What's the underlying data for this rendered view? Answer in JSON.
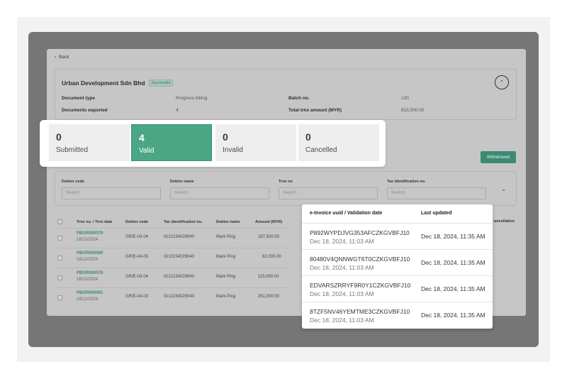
{
  "nav": {
    "back_label": "Back",
    "back_icon": "chevron-left-icon"
  },
  "summary": {
    "company": "Urban Development Sdn Bhd",
    "status": "Successful",
    "fields": [
      {
        "label": "Document type",
        "value": "Progress billing"
      },
      {
        "label": "Documents exported",
        "value": "4"
      },
      {
        "label": "Batch no.",
        "value": "130"
      },
      {
        "label": "Total trnx amount (MYR)",
        "value": "815,500.00"
      }
    ],
    "collapse_icon": "chevron-up-icon"
  },
  "stats": [
    {
      "count": "0",
      "label": "Submitted"
    },
    {
      "count": "4",
      "label": "Valid"
    },
    {
      "count": "0",
      "label": "Invalid"
    },
    {
      "count": "0",
      "label": "Cancelled"
    }
  ],
  "actions": {
    "withdrawal_label": "Withdrawal"
  },
  "filters": [
    {
      "label": "Debtor code",
      "placeholder": "Search"
    },
    {
      "label": "Debtor name",
      "placeholder": "Search"
    },
    {
      "label": "Trnx no",
      "placeholder": "Search"
    },
    {
      "label": "Tax identification no.",
      "placeholder": "Search"
    }
  ],
  "table": {
    "headers": [
      "Trnx no. / Trnx date",
      "Debtor code",
      "Tax identification no.",
      "Debtor name",
      "Amount (MYR)"
    ],
    "cancellation_header": "Cancellation",
    "rows": [
      {
        "trnx": "PBGR000079",
        "date": "18/12/2024",
        "debtor_code": "GR/E-03-04",
        "tin": "IG12154029040",
        "debtor_name": "Mark Ping",
        "amount": "287,500.00"
      },
      {
        "trnx": "PBGR000080",
        "date": "18/12/2024",
        "debtor_code": "GR/E-04-03",
        "tin": "IG12154029040",
        "debtor_name": "Mark Ping",
        "amount": "62,000.00"
      },
      {
        "trnx": "PBGR000078",
        "date": "18/12/2024",
        "debtor_code": "GR/E-03-04",
        "tin": "IG12154029040",
        "debtor_name": "Mark Ping",
        "amount": "115,000.00"
      },
      {
        "trnx": "PBGR000081",
        "date": "18/12/2024",
        "debtor_code": "GR/E-04-03",
        "tin": "IG12154029040",
        "debtor_name": "Mark Ping",
        "amount": "351,000.00"
      }
    ]
  },
  "popup": {
    "headers": [
      "e-Invoice uuid / Validation date",
      "Last updated"
    ],
    "rows": [
      {
        "uuid": "P892WYPDJVG353AFCZKGVBFJ10",
        "validation_date": "Dec 18, 2024, 11:03 AM",
        "last_updated": "Dec 18, 2024, 11:35 AM"
      },
      {
        "uuid": "80480V4QNNWGT6T0CZKGVBFJ10",
        "validation_date": "Dec 18, 2024, 11:03 AM",
        "last_updated": "Dec 18, 2024, 11:35 AM"
      },
      {
        "uuid": "EDVARSZRRYF9R0Y1CZKGVBFJ10",
        "validation_date": "Dec 18, 2024, 11:03 AM",
        "last_updated": "Dec 18, 2024, 11:35 AM"
      },
      {
        "uuid": "8TZF5NV46YEMTME3CZKGVBFJ10",
        "validation_date": "Dec 18, 2024, 11:03 AM",
        "last_updated": "Dec 18, 2024, 11:35 AM"
      }
    ]
  },
  "colors": {
    "accent": "#4aa685",
    "accent_dark": "#3d8a74"
  }
}
